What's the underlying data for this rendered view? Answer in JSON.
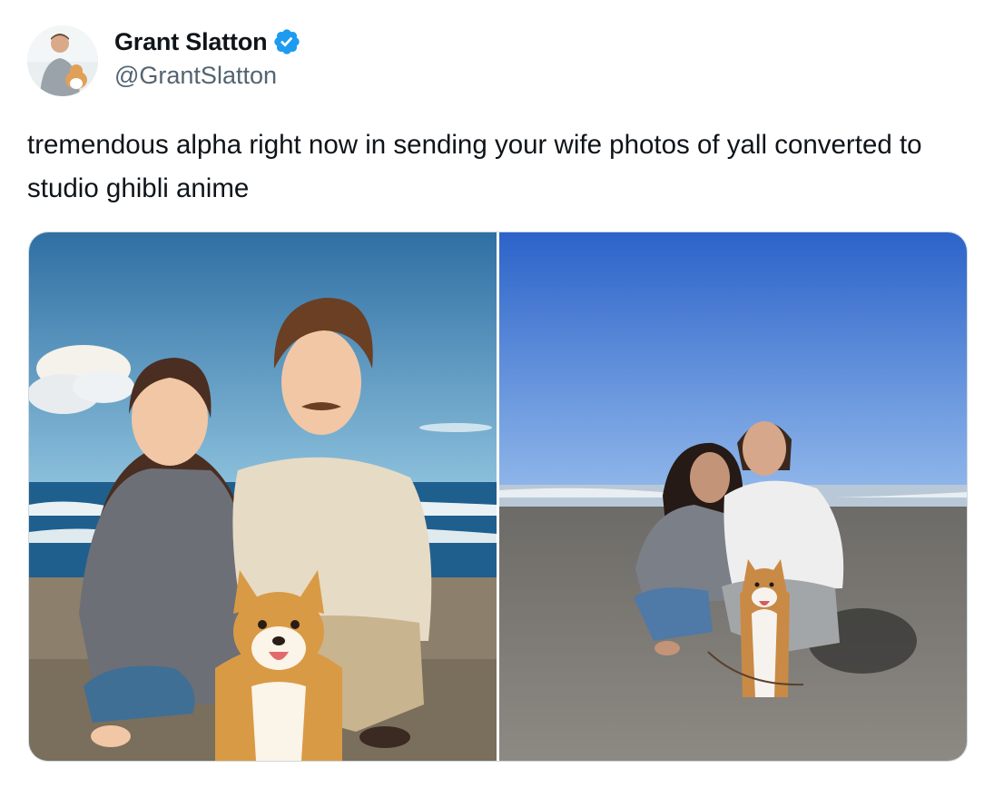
{
  "tweet": {
    "author": {
      "name": "Grant Slatton",
      "handle": "@GrantSlatton",
      "verified": true,
      "verified_color": "#1d9bf0",
      "avatar_icon": "profile-photo-avatar"
    },
    "text": "tremendous alpha right now in sending your wife photos of yall converted to studio ghibli anime",
    "media": [
      {
        "kind": "illustration",
        "style": "anime-style beach portrait of couple with corgi"
      },
      {
        "kind": "photo",
        "style": "beach photo of couple with corgi"
      }
    ]
  },
  "colors": {
    "text_primary": "#0f1419",
    "text_secondary": "#536471",
    "border": "#cfd9de"
  }
}
